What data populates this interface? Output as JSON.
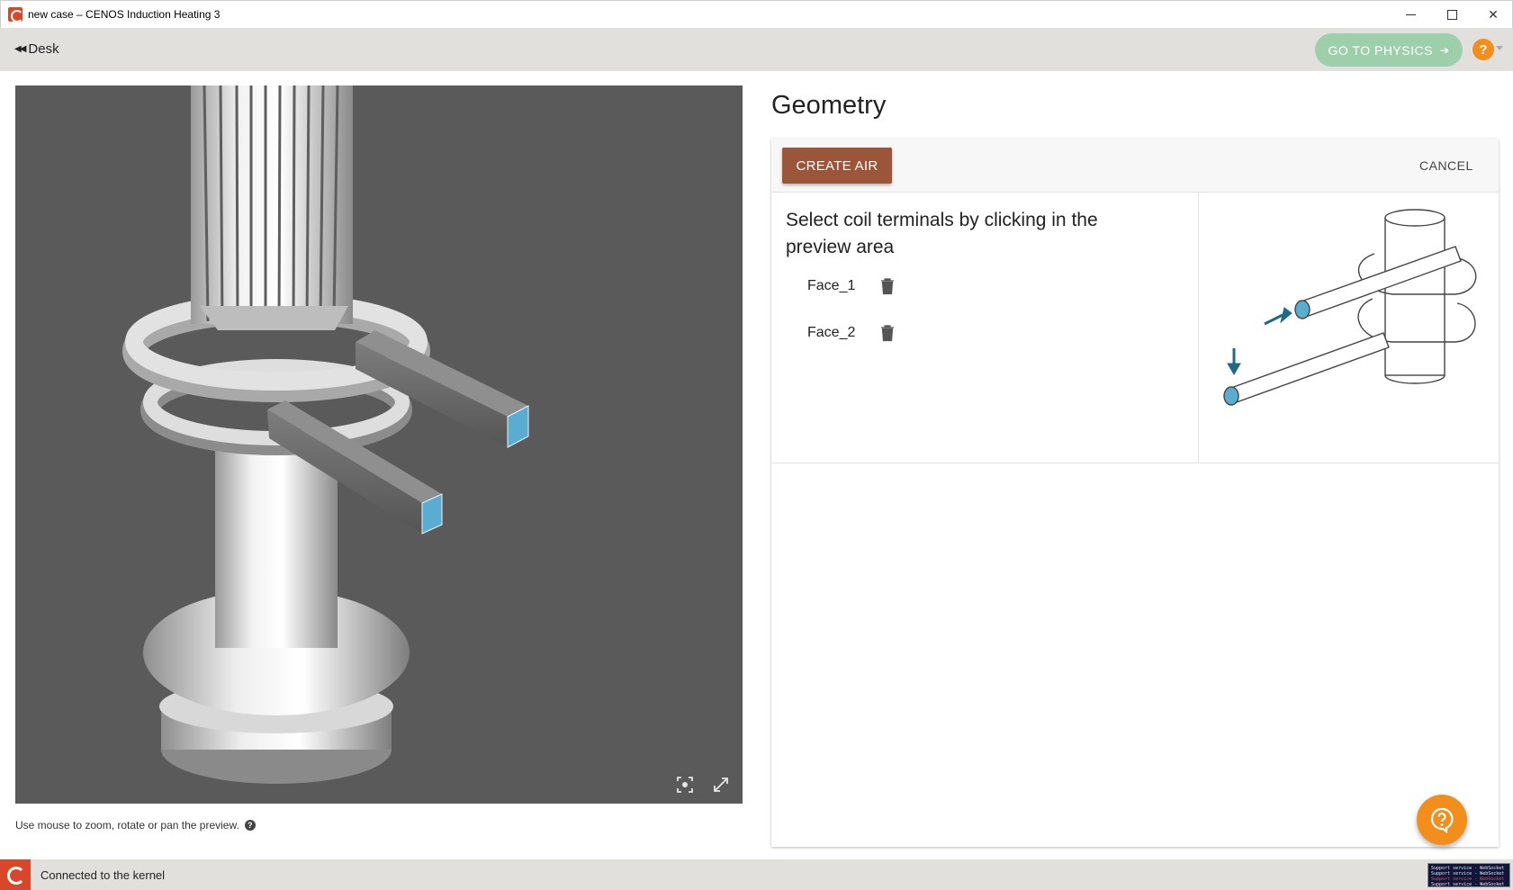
{
  "window": {
    "title": "new case – CENOS Induction Heating 3",
    "controls": [
      "minimize",
      "maximize",
      "close"
    ]
  },
  "header": {
    "back_label": "Desk",
    "primary_action": "GO TO PHYSICS",
    "help_label": "?"
  },
  "preview": {
    "hint": "Use mouse to zoom, rotate or pan the preview.",
    "hint_help": "?",
    "tools": [
      "focus-icon",
      "expand-icon"
    ]
  },
  "geometry": {
    "title": "Geometry",
    "create_air_label": "CREATE AIR",
    "cancel_label": "CANCEL",
    "instruction": "Select coil terminals by clicking in the preview area",
    "faces": [
      {
        "label": "Face_1"
      },
      {
        "label": "Face_2"
      }
    ]
  },
  "status": {
    "text": "Connected to the kernel",
    "console_lines": [
      "Support service - WebSocket",
      "Support service - WebSocket",
      "Support service - WebSocket",
      "Support service - WebSocket"
    ]
  },
  "colors": {
    "accent_brown": "#9b5539",
    "go_physics_green": "#9ccfaa",
    "help_orange": "#f28e1c",
    "terminal_blue": "#5aadd1",
    "brand_red": "#d9472b",
    "preview_bg": "#5a5a5a"
  }
}
